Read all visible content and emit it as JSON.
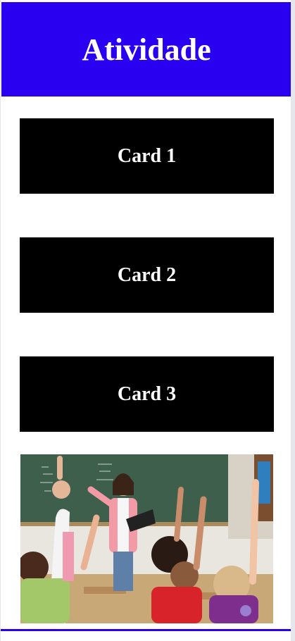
{
  "header": {
    "title": "Atividade"
  },
  "cards": [
    {
      "label": "Card 1"
    },
    {
      "label": "Card 2"
    },
    {
      "label": "Card 3"
    }
  ],
  "image": {
    "subject": "classroom-photo"
  },
  "colors": {
    "header_bg": "#2a00f0",
    "card_bg": "#000000",
    "card_text": "#ffffff",
    "accent_bar": "#2a00f0"
  }
}
